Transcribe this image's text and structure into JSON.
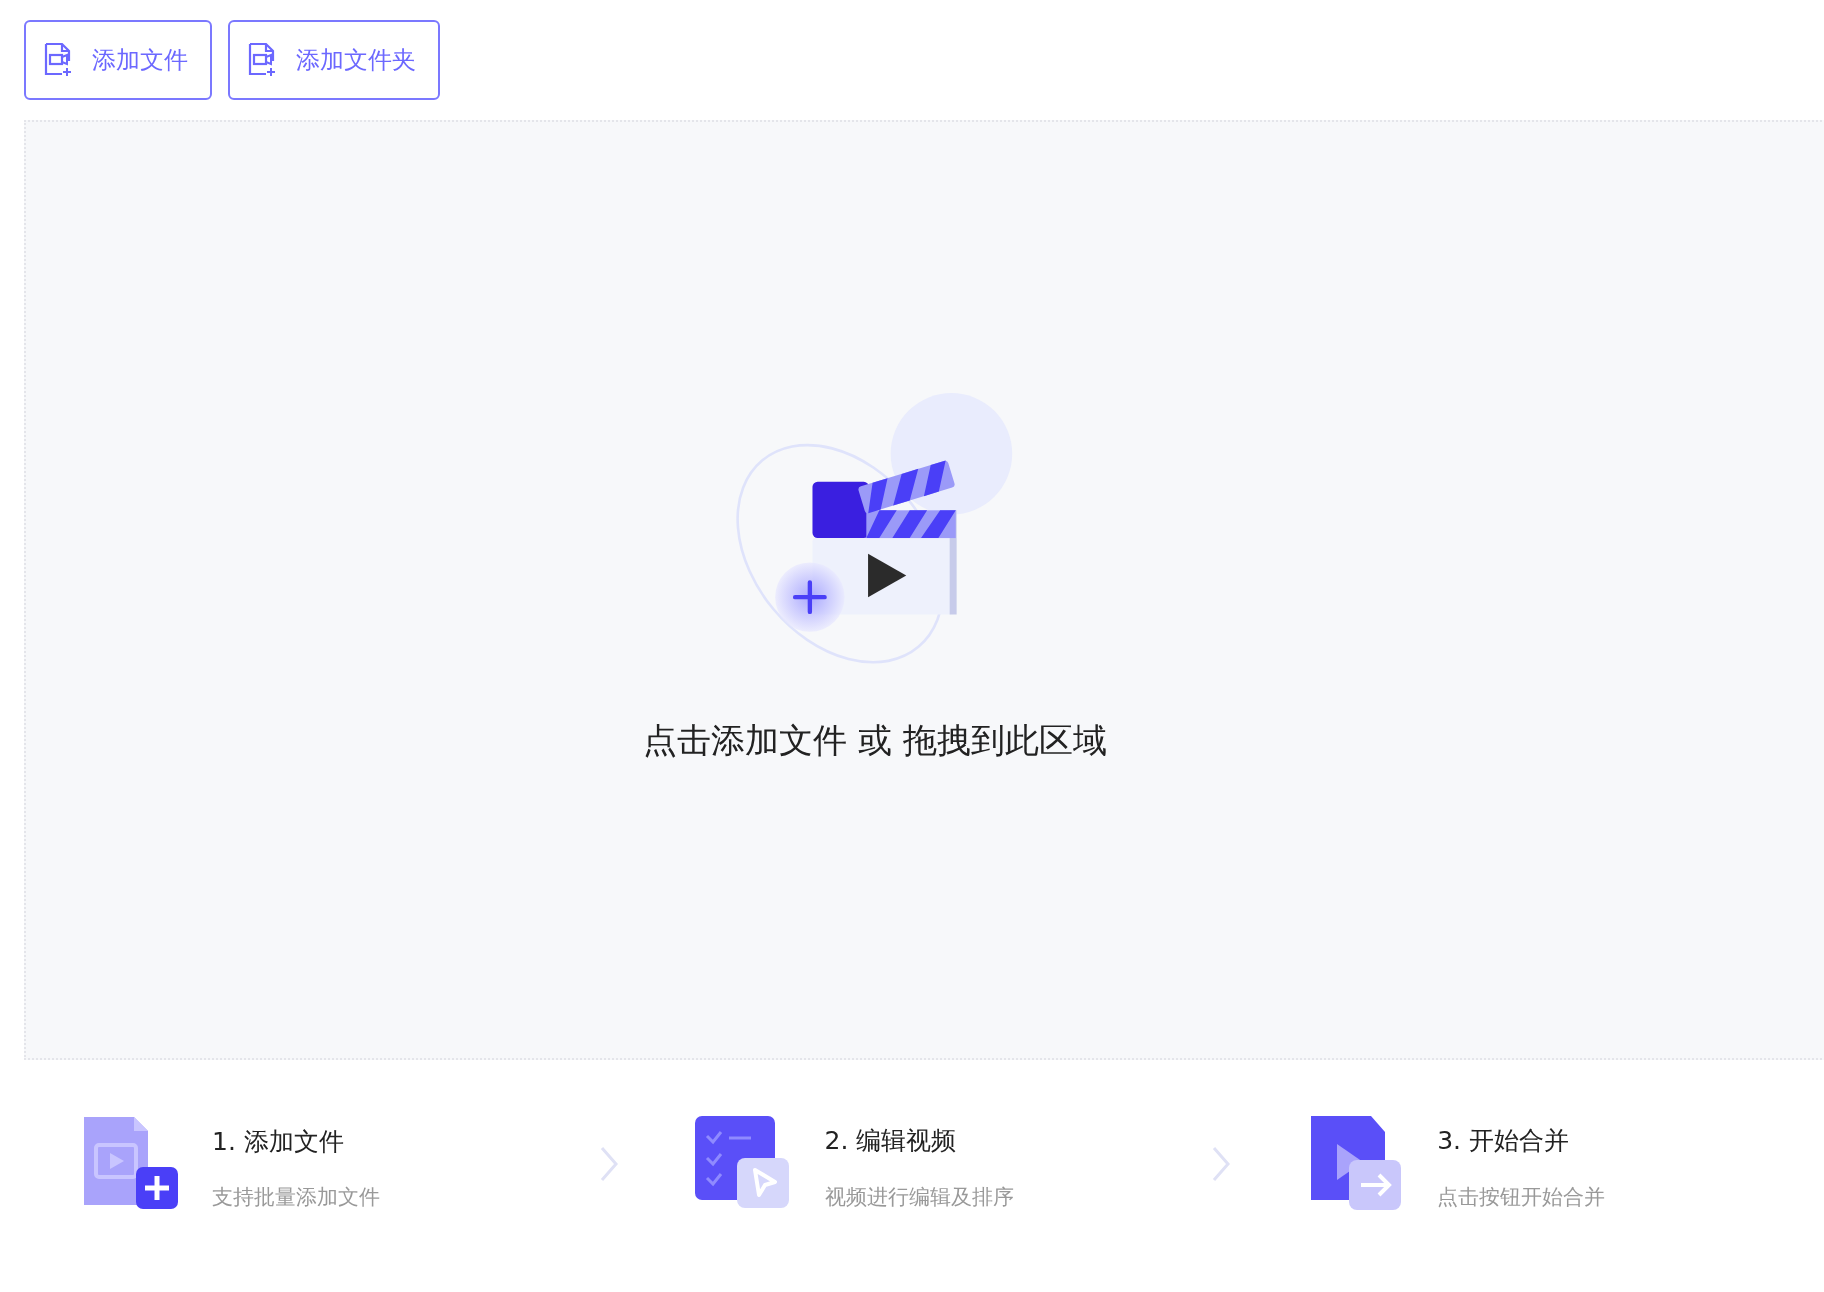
{
  "toolbar": {
    "buttons": [
      {
        "label": "添加文件"
      },
      {
        "label": "添加文件夹"
      }
    ]
  },
  "drop_zone": {
    "prompt": "点击添加文件 或 拖拽到此区域"
  },
  "steps": [
    {
      "kind": "add",
      "title": "1. 添加文件",
      "subtitle": "支持批量添加文件"
    },
    {
      "kind": "edit",
      "title": "2. 编辑视频",
      "subtitle": "视频进行编辑及排序"
    },
    {
      "kind": "merge",
      "title": "3. 开始合并",
      "subtitle": "点击按钮开始合并"
    }
  ]
}
